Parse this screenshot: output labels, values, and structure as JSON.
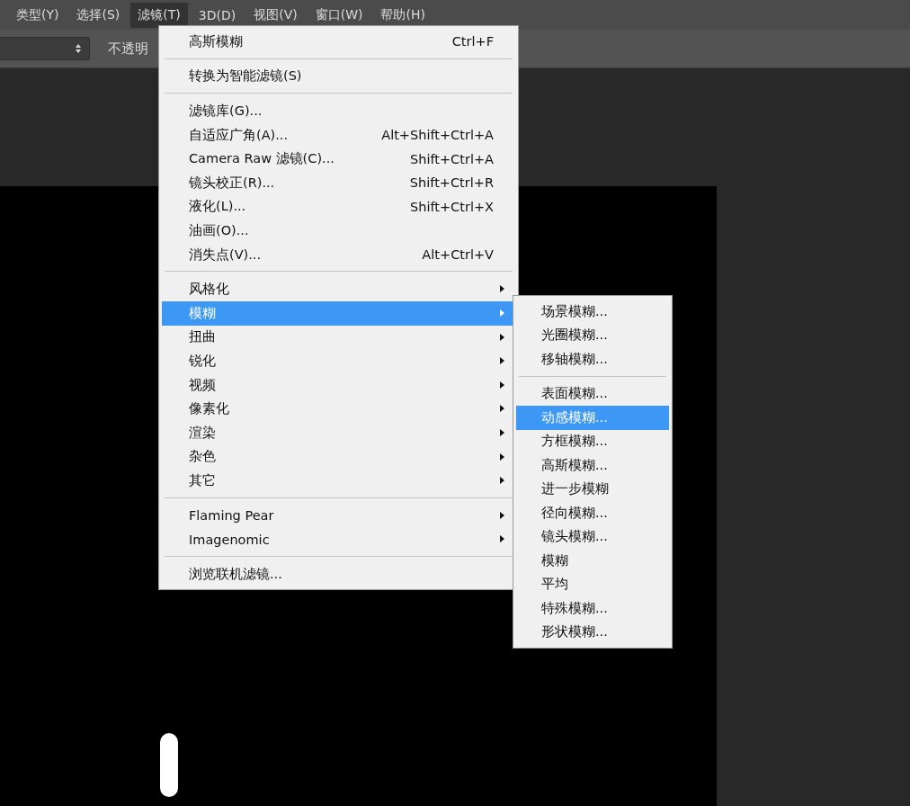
{
  "menubar": [
    {
      "label": "类型(Y)",
      "selected": false
    },
    {
      "label": "选择(S)",
      "selected": false
    },
    {
      "label": "滤镜(T)",
      "selected": true
    },
    {
      "label": "3D(D)",
      "selected": false
    },
    {
      "label": "视图(V)",
      "selected": false
    },
    {
      "label": "窗口(W)",
      "selected": false
    },
    {
      "label": "帮助(H)",
      "selected": false
    }
  ],
  "options_bar": {
    "opacity_label": "不透明"
  },
  "filter_menu": {
    "sections": [
      [
        {
          "label": "高斯模糊",
          "shortcut": "Ctrl+F",
          "submenu": false,
          "selected": false
        }
      ],
      [
        {
          "label": "转换为智能滤镜(S)",
          "submenu": false,
          "selected": false
        }
      ],
      [
        {
          "label": "滤镜库(G)...",
          "submenu": false,
          "selected": false
        },
        {
          "label": "自适应广角(A)...",
          "shortcut": "Alt+Shift+Ctrl+A",
          "submenu": false,
          "selected": false
        },
        {
          "label": "Camera Raw 滤镜(C)...",
          "shortcut": "Shift+Ctrl+A",
          "submenu": false,
          "selected": false
        },
        {
          "label": "镜头校正(R)...",
          "shortcut": "Shift+Ctrl+R",
          "submenu": false,
          "selected": false
        },
        {
          "label": "液化(L)...",
          "shortcut": "Shift+Ctrl+X",
          "submenu": false,
          "selected": false
        },
        {
          "label": "油画(O)...",
          "submenu": false,
          "selected": false
        },
        {
          "label": "消失点(V)...",
          "shortcut": "Alt+Ctrl+V",
          "submenu": false,
          "selected": false
        }
      ],
      [
        {
          "label": "风格化",
          "submenu": true,
          "selected": false
        },
        {
          "label": "模糊",
          "submenu": true,
          "selected": true
        },
        {
          "label": "扭曲",
          "submenu": true,
          "selected": false
        },
        {
          "label": "锐化",
          "submenu": true,
          "selected": false
        },
        {
          "label": "视频",
          "submenu": true,
          "selected": false
        },
        {
          "label": "像素化",
          "submenu": true,
          "selected": false
        },
        {
          "label": "渲染",
          "submenu": true,
          "selected": false
        },
        {
          "label": "杂色",
          "submenu": true,
          "selected": false
        },
        {
          "label": "其它",
          "submenu": true,
          "selected": false
        }
      ],
      [
        {
          "label": "Flaming Pear",
          "submenu": true,
          "selected": false
        },
        {
          "label": "Imagenomic",
          "submenu": true,
          "selected": false
        }
      ],
      [
        {
          "label": "浏览联机滤镜...",
          "submenu": false,
          "selected": false
        }
      ]
    ]
  },
  "blur_submenu": {
    "sections": [
      [
        {
          "label": "场景模糊...",
          "selected": false
        },
        {
          "label": "光圈模糊...",
          "selected": false
        },
        {
          "label": "移轴模糊...",
          "selected": false
        }
      ],
      [
        {
          "label": "表面模糊...",
          "selected": false
        },
        {
          "label": "动感模糊...",
          "selected": true
        },
        {
          "label": "方框模糊...",
          "selected": false
        },
        {
          "label": "高斯模糊...",
          "selected": false
        },
        {
          "label": "进一步模糊",
          "selected": false
        },
        {
          "label": "径向模糊...",
          "selected": false
        },
        {
          "label": "镜头模糊...",
          "selected": false
        },
        {
          "label": "模糊",
          "selected": false
        },
        {
          "label": "平均",
          "selected": false
        },
        {
          "label": "特殊模糊...",
          "selected": false
        },
        {
          "label": "形状模糊...",
          "selected": false
        }
      ]
    ]
  }
}
